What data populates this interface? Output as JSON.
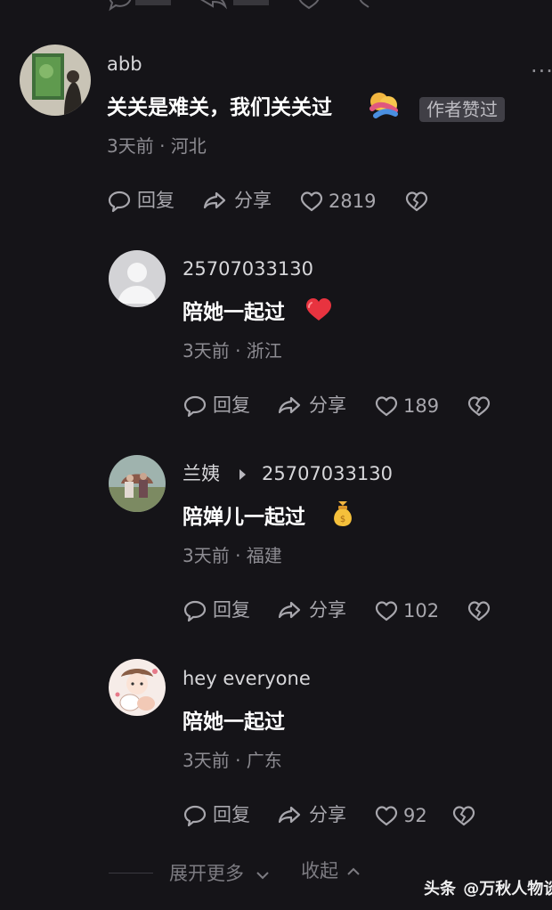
{
  "comments": [
    {
      "user": "abb",
      "text": "关关是难关，我们关关过",
      "badge": "作者赞过",
      "meta": "3天前 · 河北",
      "reply_label": "回复",
      "share_label": "分享",
      "likes": "2819"
    },
    {
      "user": "25707033130",
      "text": "陪她一起过",
      "meta": "3天前 · 浙江",
      "reply_label": "回复",
      "share_label": "分享",
      "likes": "189"
    },
    {
      "user": "兰姨",
      "reply_to": "25707033130",
      "text": "陪婵儿一起过",
      "meta": "3天前 · 福建",
      "reply_label": "回复",
      "share_label": "分享",
      "likes": "102"
    },
    {
      "user": "hey everyone",
      "text": "陪她一起过",
      "meta": "3天前 · 广东",
      "reply_label": "回复",
      "share_label": "分享",
      "likes": "92"
    }
  ],
  "footer": {
    "expand_label": "展开更多",
    "collapse_label": "收起"
  },
  "watermark": {
    "site": "头条",
    "handle": "@万秋人物谈"
  },
  "colors": {
    "background": "#151418",
    "heart_red": "#e8333f",
    "badge_bg": "#403f46"
  },
  "icons": {
    "reply": "comment-bubble-icon",
    "share": "share-arrow-icon",
    "like": "heart-outline-icon",
    "dislike": "broken-heart-icon"
  }
}
